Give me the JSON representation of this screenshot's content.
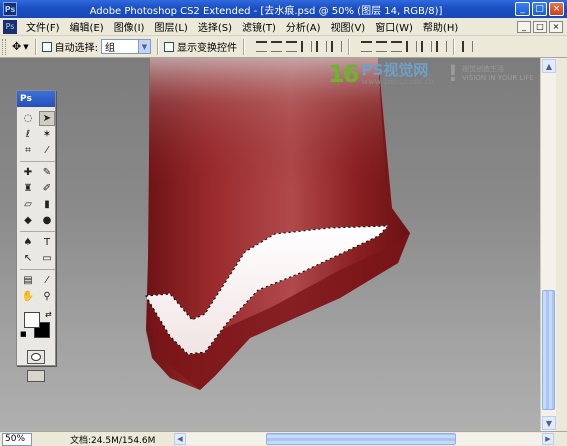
{
  "window": {
    "app_icon": "Ps",
    "title": "Adobe Photoshop CS2 Extended - [去水痕.psd @ 50% (图层 14, RGB/8)]",
    "controls": {
      "minimize": "_",
      "maximize": "□",
      "close": "×"
    }
  },
  "menubar": {
    "ps_icon": "Ps",
    "items": [
      "文件(F)",
      "编辑(E)",
      "图像(I)",
      "图层(L)",
      "选择(S)",
      "滤镜(T)",
      "分析(A)",
      "视图(V)",
      "窗口(W)",
      "帮助(H)"
    ],
    "doc_controls": [
      "_",
      "□",
      "×"
    ]
  },
  "options_bar": {
    "tool_icon": "move-tool-icon",
    "auto_select_label": "自动选择:",
    "auto_select_value": "组",
    "show_transform_label": "显示变换控件"
  },
  "toolbox": {
    "header": "Ps",
    "tools": [
      "marquee-icon",
      "move-icon",
      "lasso-icon",
      "magic-wand-icon",
      "crop-icon",
      "slice-icon",
      "healing-brush-icon",
      "brush-icon",
      "clone-stamp-icon",
      "history-brush-icon",
      "eraser-icon",
      "gradient-icon",
      "blur-icon",
      "dodge-icon",
      "pen-icon",
      "type-icon",
      "path-select-icon",
      "shape-icon",
      "notes-icon",
      "eyedropper-icon",
      "hand-icon",
      "zoom-icon"
    ],
    "colors": {
      "foreground": "#ffffff",
      "background": "#000000"
    }
  },
  "watermark": {
    "number": "16",
    "brand": "PS视觉网",
    "url": "www.16ps.com.cn",
    "slogan_line1": "视觉创造生活",
    "slogan_line2": "VISION IN YOUR LIFE"
  },
  "statusbar": {
    "zoom": "50%",
    "doc_info": "文档:24.5M/154.6M"
  },
  "colors": {
    "titlebar": "#1c4fc4",
    "canvas_bg": "#8a8a8a",
    "object_red": "#8e1f22",
    "highlight": "#ffffff"
  }
}
